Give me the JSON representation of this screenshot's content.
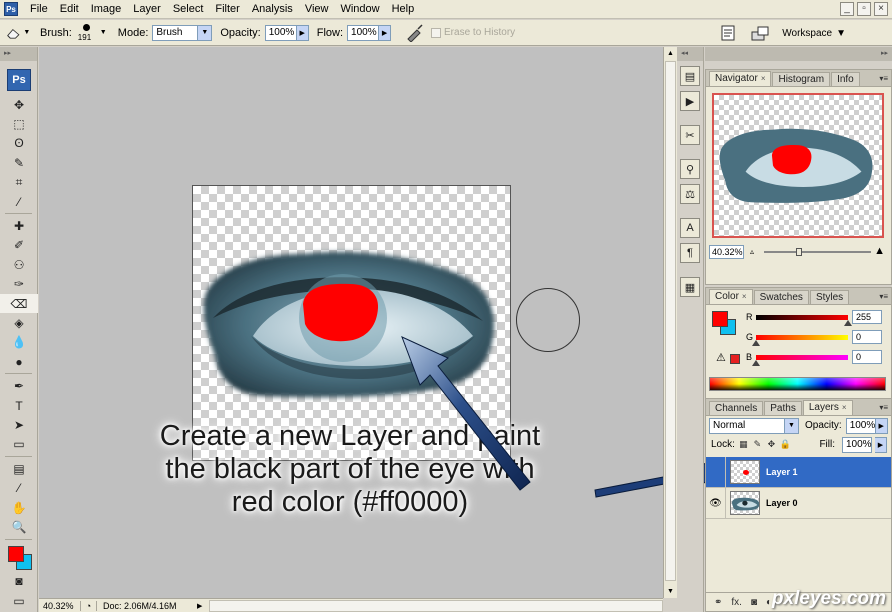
{
  "menubar": {
    "app_logo": "Ps",
    "items": [
      "File",
      "Edit",
      "Image",
      "Layer",
      "Select",
      "Filter",
      "Analysis",
      "View",
      "Window",
      "Help"
    ],
    "window_controls": [
      "_",
      "▫",
      "×"
    ]
  },
  "options_bar": {
    "tool_icon": "eraser-icon",
    "brush_label": "Brush:",
    "brush_size": "191",
    "mode_label": "Mode:",
    "mode_value": "Brush",
    "opacity_label": "Opacity:",
    "opacity_value": "100%",
    "flow_label": "Flow:",
    "flow_value": "100%",
    "erase_history_label": "Erase to History",
    "workspace_label": "Workspace"
  },
  "toolbox": {
    "badge": "Ps",
    "tools": [
      "move-icon",
      "marquee-icon",
      "lasso-icon",
      "quick-select-icon",
      "crop-icon",
      "eyedropper-icon",
      "healing-icon",
      "brush-icon",
      "stamp-icon",
      "history-brush-icon",
      "eraser-icon",
      "paint-bucket-icon",
      "blur-icon",
      "dodge-icon",
      "pen-icon",
      "type-icon",
      "path-select-icon",
      "shape-icon",
      "notes-icon",
      "eyedropper2-icon",
      "hand-icon",
      "zoom-icon"
    ],
    "tool_glyphs": [
      "✥",
      "⬚",
      "ʘ",
      "✎",
      "⌗",
      "⁄",
      "✚",
      "✐",
      "⚇",
      "✑",
      "⌫",
      "◈",
      "💧",
      "●",
      "✒",
      "T",
      "➤",
      "▭",
      "▤",
      "⁄",
      "✋",
      "🔍"
    ],
    "active_tool": "eraser-icon",
    "foreground_color": "#ff0000",
    "background_color": "#10c0f0"
  },
  "document": {
    "zoom": "40.32%",
    "doc_info": "Doc: 2.06M/4.16M",
    "annotation_lines": [
      "Create a new Layer and paint",
      "the black part of the eye with",
      "red color (#ff0000)"
    ]
  },
  "navigator_panel": {
    "tabs": [
      "Navigator",
      "Histogram",
      "Info"
    ],
    "zoom": "40.32%"
  },
  "color_panel": {
    "tabs": [
      "Color",
      "Swatches",
      "Styles"
    ],
    "channels": [
      {
        "label": "R",
        "value": "255",
        "level": 1.0
      },
      {
        "label": "G",
        "value": "0",
        "level": 0
      },
      {
        "label": "B",
        "value": "0",
        "level": 0
      }
    ]
  },
  "layers_panel": {
    "tabs": [
      "Channels",
      "Paths",
      "Layers"
    ],
    "blend_mode": "Normal",
    "opacity_label": "Opacity:",
    "opacity_value": "100%",
    "lock_label": "Lock:",
    "fill_label": "Fill:",
    "fill_value": "100%",
    "layers": [
      {
        "name": "Layer 1",
        "visible": false,
        "selected": true
      },
      {
        "name": "Layer 0",
        "visible": true,
        "selected": false
      }
    ]
  },
  "watermark": "pxleyes.com",
  "colors": {
    "accent": "#316ac5",
    "paint_red": "#ff0000",
    "eye_blue": "#4a7080"
  }
}
